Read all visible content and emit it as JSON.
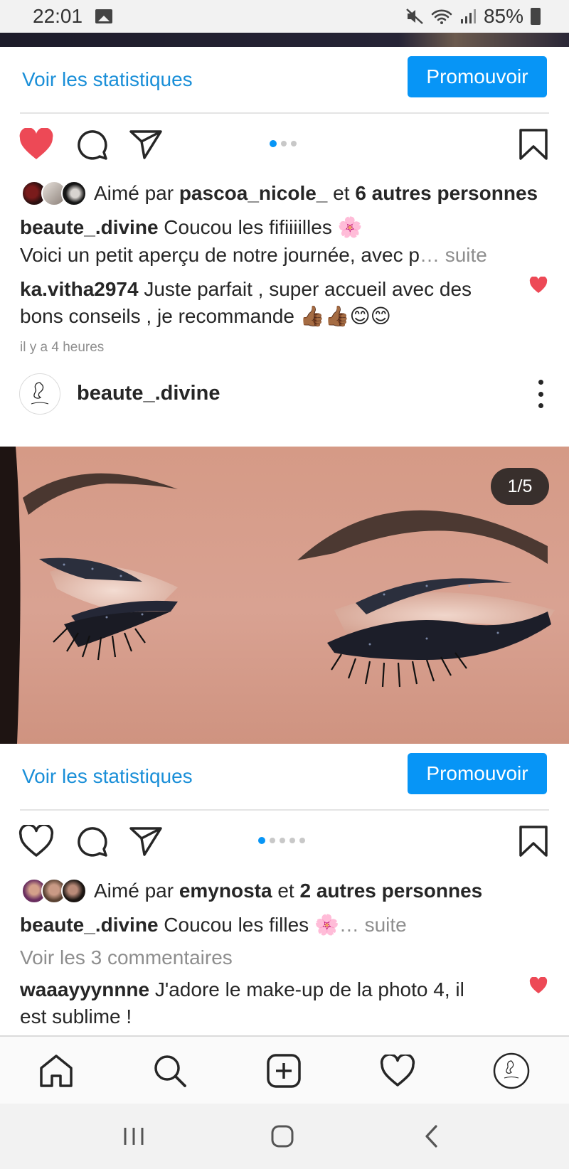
{
  "status_bar": {
    "time": "22:01",
    "battery": "85%"
  },
  "post1": {
    "stats_link": "Voir les statistiques",
    "promote_label": "Promouvoir",
    "likes_prefix": "Aimé par",
    "likes_user": "pascoa_nicole_",
    "likes_and": "et",
    "likes_others": "6 autres personnes",
    "caption_user": "beaute_.divine",
    "caption_text": "Coucou les fifiiiilles 🌸",
    "caption_line2": "Voici un petit aperçu de notre journée, avec p",
    "caption_more": "… suite",
    "comment_user": "ka.vitha2974",
    "comment_text_1": "Juste parfait , super accueil avec des",
    "comment_text_2": "bons conseils , je recommande 👍🏾👍🏾😊😊",
    "time_ago": "il y a 4 heures",
    "dots_active": 1,
    "dots_total": 3
  },
  "post2": {
    "username": "beaute_.divine",
    "counter": "1/5",
    "stats_link": "Voir les statistiques",
    "promote_label": "Promouvoir",
    "likes_prefix": "Aimé par",
    "likes_user": "emynosta",
    "likes_and": "et",
    "likes_others": "2 autres personnes",
    "caption_user": "beaute_.divine",
    "caption_text": "Coucou les filles 🌸",
    "caption_more": "… suite",
    "view_comments": "Voir les 3 commentaires",
    "comment_user": "waaayyynnne",
    "comment_text_1": "J'adore le make-up de la photo 4,  il",
    "comment_text_2": "est sublime !",
    "dots_active": 1,
    "dots_total": 5
  },
  "icons": {
    "like_filled": "heart-filled-icon",
    "like": "heart-icon",
    "comment": "comment-icon",
    "share": "send-icon",
    "save": "bookmark-icon",
    "more": "more-vertical-icon",
    "home": "home-icon",
    "search": "search-icon",
    "new_post": "add-post-icon",
    "activity": "heart-icon",
    "profile": "profile-avatar-icon"
  },
  "colors": {
    "accent": "#0795f6",
    "link": "#1a8fd8",
    "like_red": "#ed4956"
  }
}
